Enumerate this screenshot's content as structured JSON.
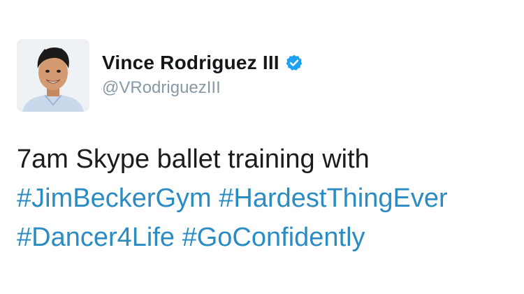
{
  "author": {
    "name": "Vince Rodriguez III",
    "handle": "@VRodriguezIII",
    "verified_icon": "verified-badge-icon",
    "verified_color": "#1da1f2"
  },
  "tweet": {
    "text_line1": "7am Skype ballet training with",
    "hashtags": [
      "#JimBeckerGym",
      "#HardestThingEver",
      "#Dancer4Life",
      "#GoConfidently"
    ],
    "hashtag_color": "#2b8cc4"
  }
}
